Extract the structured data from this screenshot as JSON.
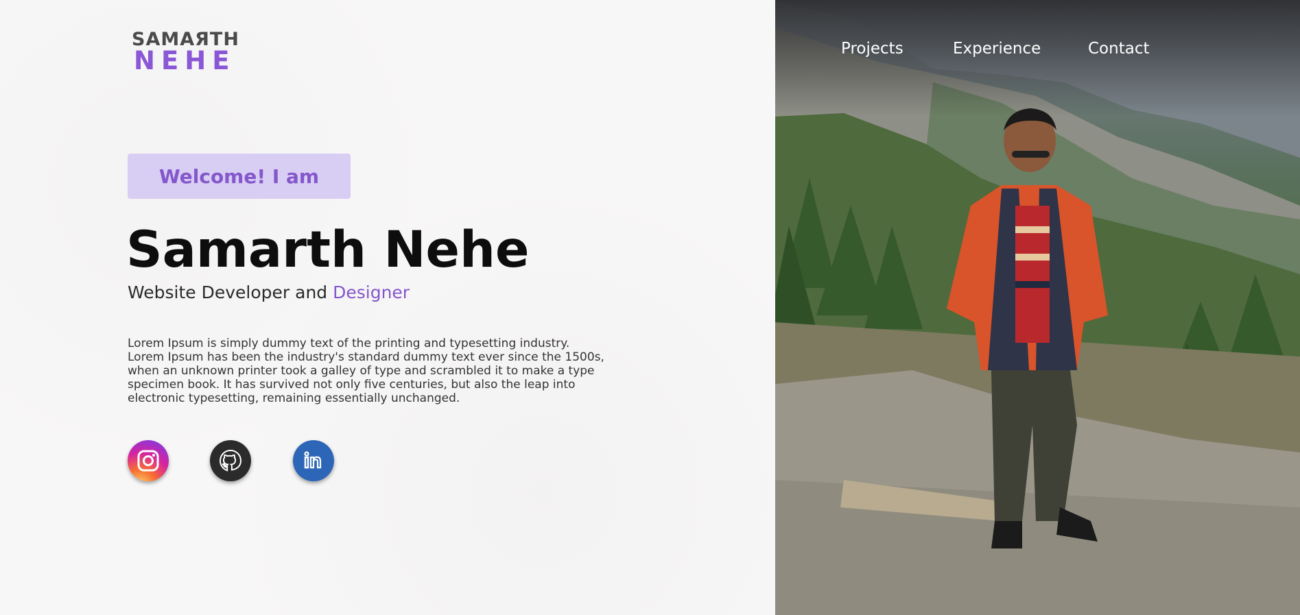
{
  "logo": {
    "top": "SAMAЯTH",
    "bottom": "NEHE",
    "top_color": "#4a4a4a",
    "bottom_color": "#8a58d6"
  },
  "nav": {
    "items": [
      "Projects",
      "Experience",
      "Contact"
    ]
  },
  "hero": {
    "welcome": "Welcome! I am",
    "name": "Samarth Nehe",
    "role_prefix": "Website Developer and ",
    "role_accent": "Designer",
    "description": "Lorem Ipsum is simply dummy text of the printing and typesetting industry. Lorem Ipsum has been the industry's standard dummy text ever since the 1500s, when an unknown printer took a galley of type and scrambled it to make a type specimen book. It has survived not only five centuries, but also the leap into electronic typesetting, remaining essentially unchanged."
  },
  "social": [
    {
      "name": "instagram",
      "icon": "instagram-icon"
    },
    {
      "name": "github",
      "icon": "github-icon"
    },
    {
      "name": "linkedin",
      "icon": "linkedin-icon"
    }
  ],
  "colors": {
    "accent": "#8457cc",
    "welcome_bg": "#d8cdf2"
  }
}
